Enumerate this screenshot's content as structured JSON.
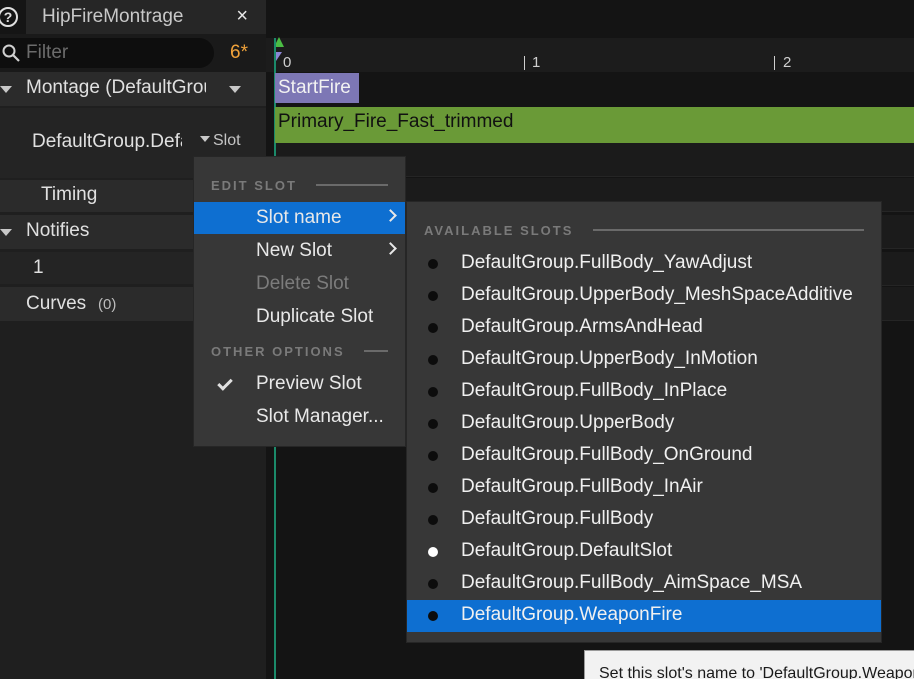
{
  "tab": {
    "title": "HipFireMontrage",
    "close_glyph": "×"
  },
  "help_icon": {
    "glyph": "?"
  },
  "filter": {
    "placeholder": "Filter",
    "value": "",
    "count": "6*"
  },
  "tree": {
    "montage_label": "Montage (DefaultGroup)",
    "slot_name": "DefaultGroup.DefaultSlot",
    "slot_dropdown_label": "Slot",
    "timing_label": "Timing",
    "notifies_label": "Notifies",
    "notify_track_label": "1",
    "curves_label": "Curves",
    "curves_count": "(0)"
  },
  "timeline": {
    "ticks": [
      "0",
      "1",
      "2"
    ],
    "section_label": "StartFire",
    "segment_label": "Primary_Fire_Fast_trimmed"
  },
  "context_menu": {
    "edit_slot_heading": "EDIT SLOT",
    "other_options_heading": "OTHER OPTIONS",
    "items": {
      "slot_name": "Slot name",
      "new_slot": "New Slot",
      "delete_slot": "Delete Slot",
      "duplicate_slot": "Duplicate Slot",
      "preview_slot": "Preview Slot",
      "slot_manager": "Slot Manager..."
    }
  },
  "submenu": {
    "heading": "AVAILABLE SLOTS",
    "current_slot_index": 9,
    "highlighted_slot_index": 11,
    "slots": [
      "DefaultGroup.FullBody_YawAdjust",
      "DefaultGroup.UpperBody_MeshSpaceAdditive",
      "DefaultGroup.ArmsAndHead",
      "DefaultGroup.UpperBody_InMotion",
      "DefaultGroup.FullBody_InPlace",
      "DefaultGroup.UpperBody",
      "DefaultGroup.FullBody_OnGround",
      "DefaultGroup.FullBody_InAir",
      "DefaultGroup.FullBody",
      "DefaultGroup.DefaultSlot",
      "DefaultGroup.FullBody_AimSpace_MSA",
      "DefaultGroup.WeaponFire"
    ]
  },
  "tooltip": {
    "text": "Set this slot's name to 'DefaultGroup.WeaponFire'"
  },
  "colors": {
    "accent": "#0e6fd1",
    "section_bar": "#7d77b5",
    "anim_segment": "#6a9a37",
    "filter_count": "#f0a23a"
  },
  "icons": [
    "help-icon",
    "close-icon",
    "search-icon",
    "chevron-down-icon",
    "chevron-right-icon",
    "check-icon",
    "bullet-icon"
  ]
}
